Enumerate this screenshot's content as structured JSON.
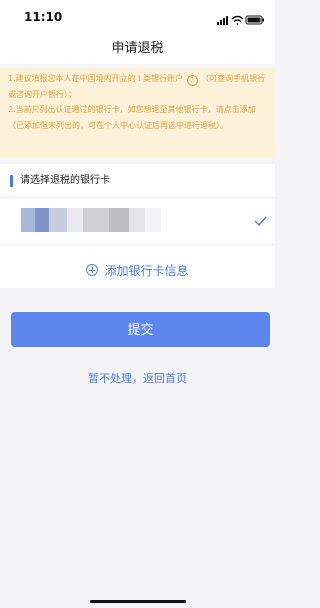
{
  "status_bar": {
    "time": "11:10",
    "icons": [
      "signal-icon",
      "wifi-icon",
      "battery-icon"
    ]
  },
  "nav": {
    "title": "申请退税"
  },
  "notice": {
    "line1_a": "1.建议填报您本人在中国境内开立的 I 类银行账户",
    "line1_b": "（可查询手机银行或咨询开户银行）；",
    "line2": "2.当前只列出认证通过的银行卡，如您想退至其他银行卡，请点击添加（已添加但未列出的，可在个人中心认证后再选中进行退税）。",
    "color": "#e0a13b",
    "background": "#fdf1d9"
  },
  "section": {
    "title": "请选择退税的银行卡"
  },
  "bank_card": {
    "selected": true,
    "mask_colors": [
      "#a9b7d6",
      "#7f95c7",
      "#c7cde0",
      "#e9e9ef",
      "#cfcfd4",
      "#bdbdc3",
      "#e4e4e8",
      "#f3f3f5"
    ]
  },
  "add_card": {
    "label": "添加银行卡信息"
  },
  "submit": {
    "label": "提交"
  },
  "back": {
    "label": "暂不处理，返回首页"
  },
  "colors": {
    "accent": "#4b7bec",
    "button": "#5a86ee"
  }
}
